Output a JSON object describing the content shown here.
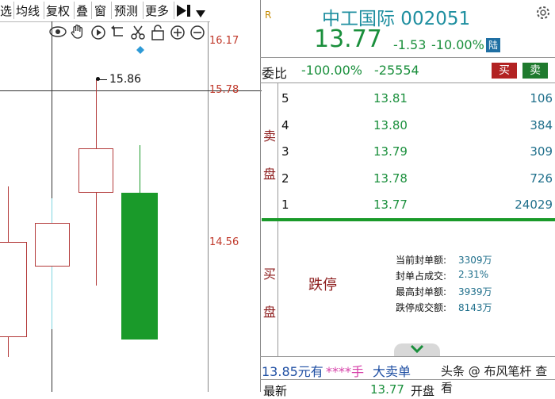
{
  "toolbar": {
    "items": [
      "选",
      "均线",
      "复权",
      "叠",
      "窗",
      "预测",
      "更多"
    ],
    "end_icons": [
      "skip-end-icon",
      "dropdown-icon"
    ]
  },
  "chart_tools": [
    "eye-icon",
    "hand-icon",
    "play-icon",
    "return-icon",
    "scissors-icon",
    "lock-icon",
    "zoom-in-icon",
    "zoom-out-icon"
  ],
  "price_axis": [
    "16.17",
    "15.78",
    "14.56"
  ],
  "annotation": {
    "high_label": "15.86"
  },
  "stock": {
    "badge": "R",
    "name_code": "中工国际 002051",
    "price": "13.77",
    "change": "-1.53",
    "change_pct": "-10.00%",
    "market_tag": "陆"
  },
  "weibi": {
    "label": "委比",
    "pct": "-100.00%",
    "diff": "-25554",
    "buy_label": "买",
    "sell_label": "卖"
  },
  "sell_side": {
    "label_top": "卖",
    "label_bottom": "盘",
    "rows": [
      {
        "level": "5",
        "price": "13.81",
        "volume": "106"
      },
      {
        "level": "4",
        "price": "13.80",
        "volume": "384"
      },
      {
        "level": "3",
        "price": "13.79",
        "volume": "309"
      },
      {
        "level": "2",
        "price": "13.78",
        "volume": "726"
      },
      {
        "level": "1",
        "price": "13.77",
        "volume": "24029"
      }
    ]
  },
  "buy_side": {
    "label_top": "买",
    "label_bottom": "盘",
    "limit_text": "跌停",
    "seal": [
      {
        "key": "当前封单额:",
        "value": "3309万"
      },
      {
        "key": "封单占成交:",
        "value": "2.31%"
      },
      {
        "key": "最高封单额:",
        "value": "3939万"
      },
      {
        "key": "跌停成交额:",
        "value": "8143万"
      }
    ]
  },
  "ticker": {
    "amount": "13.85元有",
    "stars": "****手",
    "text": "大卖单",
    "right": "头条 @ 布风笔杆 查看"
  },
  "bottom_row": {
    "label": "最新",
    "value": "13.77",
    "label2": "开盘"
  }
}
